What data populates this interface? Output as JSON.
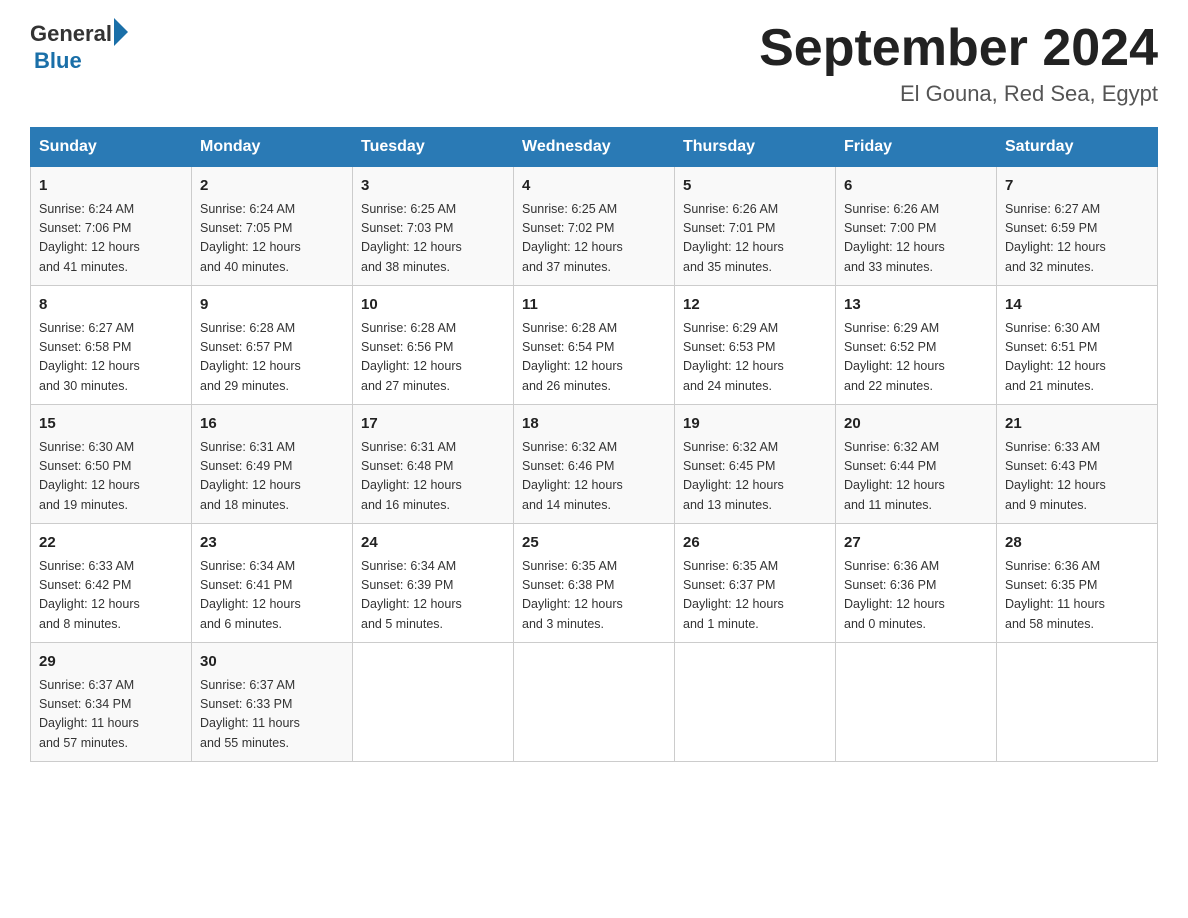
{
  "header": {
    "logo_text_general": "General",
    "logo_text_blue": "Blue",
    "title": "September 2024",
    "subtitle": "El Gouna, Red Sea, Egypt"
  },
  "days_of_week": [
    "Sunday",
    "Monday",
    "Tuesday",
    "Wednesday",
    "Thursday",
    "Friday",
    "Saturday"
  ],
  "weeks": [
    [
      {
        "day": "1",
        "sunrise": "6:24 AM",
        "sunset": "7:06 PM",
        "daylight": "12 hours and 41 minutes."
      },
      {
        "day": "2",
        "sunrise": "6:24 AM",
        "sunset": "7:05 PM",
        "daylight": "12 hours and 40 minutes."
      },
      {
        "day": "3",
        "sunrise": "6:25 AM",
        "sunset": "7:03 PM",
        "daylight": "12 hours and 38 minutes."
      },
      {
        "day": "4",
        "sunrise": "6:25 AM",
        "sunset": "7:02 PM",
        "daylight": "12 hours and 37 minutes."
      },
      {
        "day": "5",
        "sunrise": "6:26 AM",
        "sunset": "7:01 PM",
        "daylight": "12 hours and 35 minutes."
      },
      {
        "day": "6",
        "sunrise": "6:26 AM",
        "sunset": "7:00 PM",
        "daylight": "12 hours and 33 minutes."
      },
      {
        "day": "7",
        "sunrise": "6:27 AM",
        "sunset": "6:59 PM",
        "daylight": "12 hours and 32 minutes."
      }
    ],
    [
      {
        "day": "8",
        "sunrise": "6:27 AM",
        "sunset": "6:58 PM",
        "daylight": "12 hours and 30 minutes."
      },
      {
        "day": "9",
        "sunrise": "6:28 AM",
        "sunset": "6:57 PM",
        "daylight": "12 hours and 29 minutes."
      },
      {
        "day": "10",
        "sunrise": "6:28 AM",
        "sunset": "6:56 PM",
        "daylight": "12 hours and 27 minutes."
      },
      {
        "day": "11",
        "sunrise": "6:28 AM",
        "sunset": "6:54 PM",
        "daylight": "12 hours and 26 minutes."
      },
      {
        "day": "12",
        "sunrise": "6:29 AM",
        "sunset": "6:53 PM",
        "daylight": "12 hours and 24 minutes."
      },
      {
        "day": "13",
        "sunrise": "6:29 AM",
        "sunset": "6:52 PM",
        "daylight": "12 hours and 22 minutes."
      },
      {
        "day": "14",
        "sunrise": "6:30 AM",
        "sunset": "6:51 PM",
        "daylight": "12 hours and 21 minutes."
      }
    ],
    [
      {
        "day": "15",
        "sunrise": "6:30 AM",
        "sunset": "6:50 PM",
        "daylight": "12 hours and 19 minutes."
      },
      {
        "day": "16",
        "sunrise": "6:31 AM",
        "sunset": "6:49 PM",
        "daylight": "12 hours and 18 minutes."
      },
      {
        "day": "17",
        "sunrise": "6:31 AM",
        "sunset": "6:48 PM",
        "daylight": "12 hours and 16 minutes."
      },
      {
        "day": "18",
        "sunrise": "6:32 AM",
        "sunset": "6:46 PM",
        "daylight": "12 hours and 14 minutes."
      },
      {
        "day": "19",
        "sunrise": "6:32 AM",
        "sunset": "6:45 PM",
        "daylight": "12 hours and 13 minutes."
      },
      {
        "day": "20",
        "sunrise": "6:32 AM",
        "sunset": "6:44 PM",
        "daylight": "12 hours and 11 minutes."
      },
      {
        "day": "21",
        "sunrise": "6:33 AM",
        "sunset": "6:43 PM",
        "daylight": "12 hours and 9 minutes."
      }
    ],
    [
      {
        "day": "22",
        "sunrise": "6:33 AM",
        "sunset": "6:42 PM",
        "daylight": "12 hours and 8 minutes."
      },
      {
        "day": "23",
        "sunrise": "6:34 AM",
        "sunset": "6:41 PM",
        "daylight": "12 hours and 6 minutes."
      },
      {
        "day": "24",
        "sunrise": "6:34 AM",
        "sunset": "6:39 PM",
        "daylight": "12 hours and 5 minutes."
      },
      {
        "day": "25",
        "sunrise": "6:35 AM",
        "sunset": "6:38 PM",
        "daylight": "12 hours and 3 minutes."
      },
      {
        "day": "26",
        "sunrise": "6:35 AM",
        "sunset": "6:37 PM",
        "daylight": "12 hours and 1 minute."
      },
      {
        "day": "27",
        "sunrise": "6:36 AM",
        "sunset": "6:36 PM",
        "daylight": "12 hours and 0 minutes."
      },
      {
        "day": "28",
        "sunrise": "6:36 AM",
        "sunset": "6:35 PM",
        "daylight": "11 hours and 58 minutes."
      }
    ],
    [
      {
        "day": "29",
        "sunrise": "6:37 AM",
        "sunset": "6:34 PM",
        "daylight": "11 hours and 57 minutes."
      },
      {
        "day": "30",
        "sunrise": "6:37 AM",
        "sunset": "6:33 PM",
        "daylight": "11 hours and 55 minutes."
      },
      null,
      null,
      null,
      null,
      null
    ]
  ],
  "labels": {
    "sunrise": "Sunrise:",
    "sunset": "Sunset:",
    "daylight": "Daylight:"
  }
}
